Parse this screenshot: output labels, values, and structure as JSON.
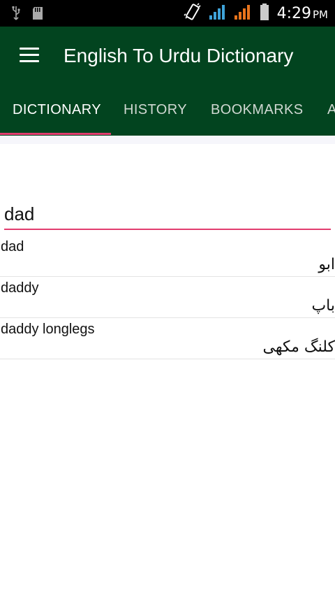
{
  "status_bar": {
    "time": "4:29",
    "ampm": "PM",
    "icons": [
      "usb-icon",
      "sd-card-icon",
      "vibrate-icon",
      "signal-icon",
      "signal-icon",
      "battery-icon"
    ]
  },
  "app_bar": {
    "title": "English To Urdu Dictionary"
  },
  "tabs": [
    {
      "label": "DICTIONARY"
    },
    {
      "label": "HISTORY"
    },
    {
      "label": "BOOKMARKS"
    },
    {
      "label": "A"
    }
  ],
  "search": {
    "value": "dad"
  },
  "results": [
    {
      "english": "dad",
      "urdu": "ابو"
    },
    {
      "english": "daddy",
      "urdu": "باپ"
    },
    {
      "english": "daddy longlegs",
      "urdu": "کلنگ مکھی"
    }
  ],
  "colors": {
    "primary": "#02441f",
    "accent": "#e23d6f"
  }
}
